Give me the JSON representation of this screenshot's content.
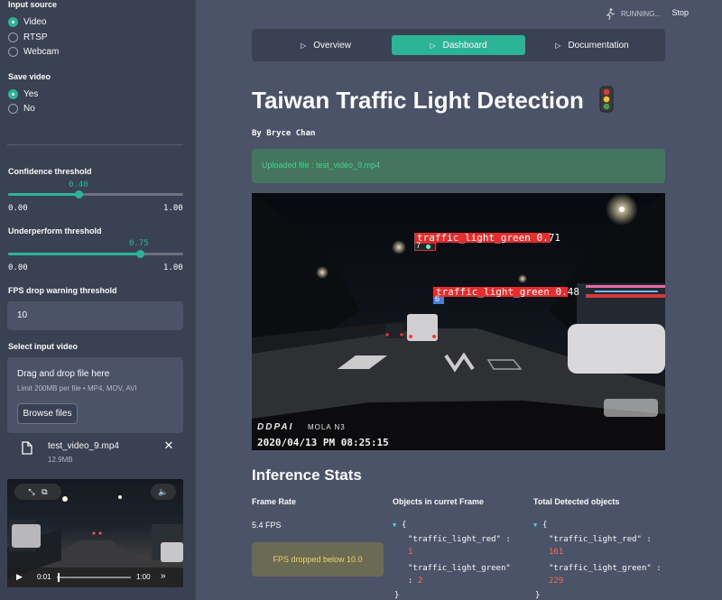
{
  "sidebar": {
    "input_source": {
      "label": "Input source",
      "options": [
        "Video",
        "RTSP",
        "Webcam"
      ],
      "selected": "Video"
    },
    "save_video": {
      "label": "Save video",
      "options": [
        "Yes",
        "No"
      ],
      "selected": "Yes"
    },
    "confidence": {
      "label": "Confidence threshold",
      "value": "0.40",
      "min": "0.00",
      "max": "1.00",
      "fraction": 0.4
    },
    "underperform": {
      "label": "Underperform threshold",
      "value": "0.75",
      "min": "0.00",
      "max": "1.00",
      "fraction": 0.75
    },
    "fps_warning": {
      "label": "FPS drop warning threshold",
      "value": "10"
    },
    "select_video": {
      "label": "Select input video"
    },
    "dropzone": {
      "title": "Drag and drop file here",
      "limit": "Limit 200MB per file • MP4, MOV, AVI",
      "button": "Browse files"
    },
    "file": {
      "name": "test_video_9.mp4",
      "size": "12.9MB"
    },
    "player": {
      "time_current": "0:01",
      "time_total": "1:00",
      "progress": 0.017
    }
  },
  "header": {
    "status": "RUNNING...",
    "stop": "Stop"
  },
  "nav": {
    "tabs": [
      "Overview",
      "Dashboard",
      "Documentation"
    ],
    "active": "Dashboard"
  },
  "main": {
    "title": "Taiwan Traffic Light Detection",
    "author": "By Bryce Chan",
    "upload_message": "Uploaded file : test_video_9.mp4",
    "video": {
      "detections": [
        {
          "label": "traffic_light_green 0.71",
          "id": "7"
        },
        {
          "label": "traffic_light_green 0.48",
          "id": "6"
        }
      ],
      "dashcam_brand": "DDPAI",
      "dashcam_model": "MOLA N3",
      "timestamp": "2020/04/13 PM 08:25:15"
    },
    "stats_title": "Inference Stats",
    "frame_rate": {
      "header": "Frame Rate",
      "value": "5.4 FPS",
      "warning": "FPS dropped below 10.0"
    },
    "current_frame": {
      "header": "Objects in curret Frame",
      "open": "{",
      "k1": "\"traffic_light_red\"",
      "v1": "1",
      "k2": "\"traffic_light_green\"",
      "v2": "2",
      "close": "}"
    },
    "total_detected": {
      "header": "Total Detected objects",
      "open": "{",
      "k1": "\"traffic_light_red\"",
      "v1": "161",
      "k2": "\"traffic_light_green\"",
      "v2": "229",
      "close": "}"
    }
  },
  "colors": {
    "accent": "#2bb596",
    "sidebar_bg": "#3a4152",
    "main_bg": "#4a5367",
    "detection_box": "#e52d2d"
  }
}
